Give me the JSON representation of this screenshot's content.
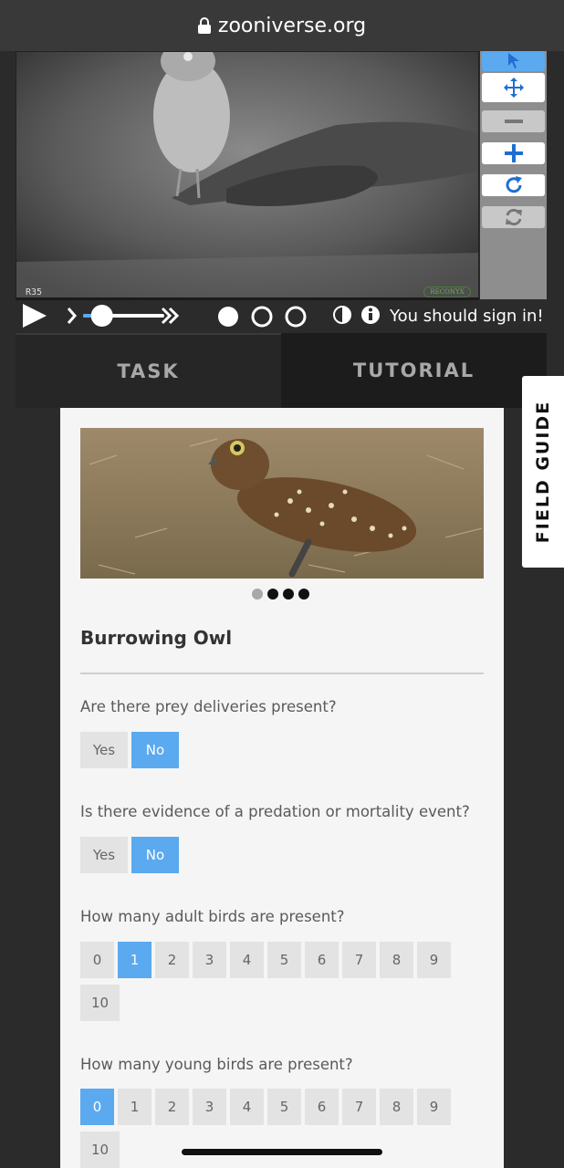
{
  "browser": {
    "url": "zooniverse.org"
  },
  "camera": {
    "stamp": "R35",
    "brand": "RECONYX"
  },
  "toolbar": {
    "tools": [
      {
        "name": "pointer-icon",
        "active": true
      },
      {
        "name": "move-icon"
      },
      {
        "name": "zoom-out-icon",
        "muted": true
      },
      {
        "name": "zoom-in-icon"
      },
      {
        "name": "rotate-icon"
      },
      {
        "name": "reset-icon",
        "muted": true
      }
    ]
  },
  "playback": {
    "sign_in_message": "You should sign in!",
    "slider_level": 0.22
  },
  "tabs": {
    "task": "TASK",
    "tutorial": "TUTORIAL"
  },
  "field_guide": {
    "label": "FIELD GUIDE"
  },
  "species": {
    "name": "Burrowing Owl",
    "image_count": 4,
    "current_image": 0
  },
  "questions": [
    {
      "text": "Are there prey deliveries present?",
      "options": [
        "Yes",
        "No"
      ],
      "selected": "No"
    },
    {
      "text": "Is there evidence of a predation or mortality event?",
      "options": [
        "Yes",
        "No"
      ],
      "selected": "No"
    },
    {
      "text": "How many adult birds are present?",
      "options": [
        "0",
        "1",
        "2",
        "3",
        "4",
        "5",
        "6",
        "7",
        "8",
        "9",
        "10"
      ],
      "selected": "1"
    },
    {
      "text": "How many young birds are present?",
      "options": [
        "0",
        "1",
        "2",
        "3",
        "4",
        "5",
        "6",
        "7",
        "8",
        "9",
        "10"
      ],
      "selected": "0"
    }
  ],
  "colors": {
    "accent": "#5ba9ef",
    "panel": "#f5f5f5",
    "background": "#2b2b2b"
  }
}
